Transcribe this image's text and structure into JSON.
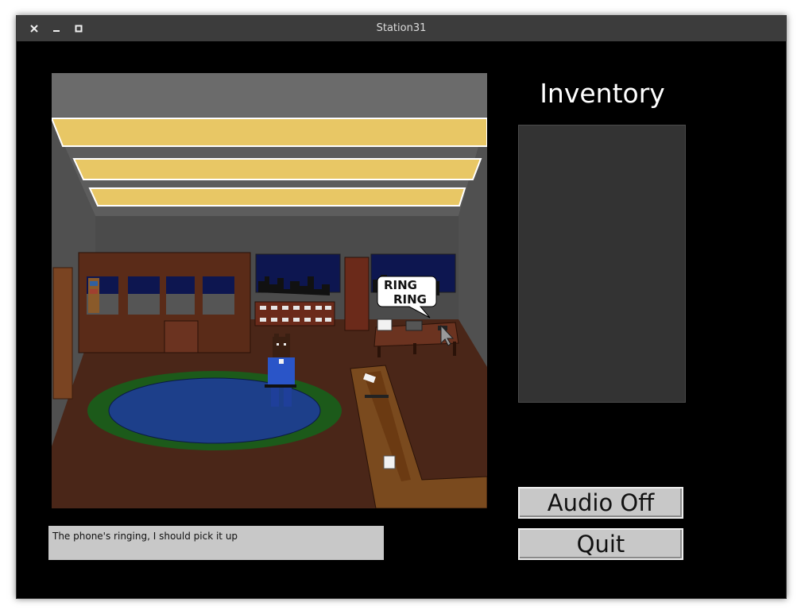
{
  "window": {
    "title": "Station31"
  },
  "scene": {
    "speech_bubble": {
      "line1": "RING",
      "line2": "RING"
    }
  },
  "inventory": {
    "title": "Inventory",
    "items": []
  },
  "buttons": {
    "audio_label": "Audio Off",
    "quit_label": "Quit"
  },
  "message": {
    "text": "The phone's ringing, I should pick it up"
  },
  "colors": {
    "titlebar": "#3c3c3c",
    "background": "#000000",
    "inventory_panel": "#333333",
    "button_face": "#c8c8c8",
    "light_panel": "#e8c765",
    "rug": "#1d3f8a",
    "floor": "#4a2618"
  },
  "icons": [
    "close-icon",
    "minimize-icon",
    "maximize-icon",
    "mouse-pointer-icon"
  ]
}
